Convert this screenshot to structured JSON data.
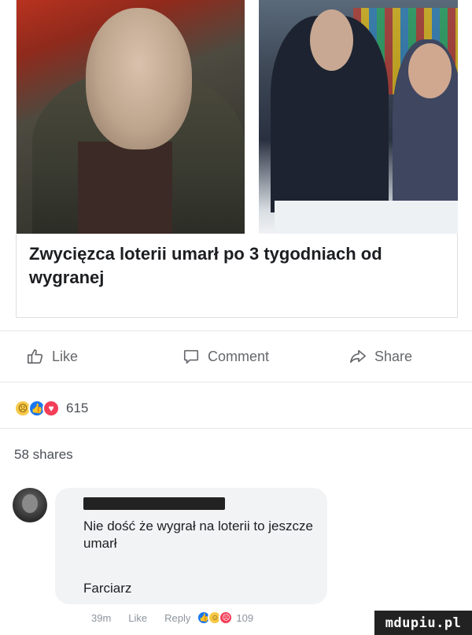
{
  "post": {
    "title": "Zwycięzca loterii umarł po 3 tygodniach od wygranej"
  },
  "actions": {
    "like_label": "Like",
    "comment_label": "Comment",
    "share_label": "Share"
  },
  "reactions": {
    "icons": [
      "sad-icon",
      "like-icon",
      "love-icon"
    ],
    "count": "615"
  },
  "shares": {
    "label": "58 shares"
  },
  "comment": {
    "text": "Nie dość że wygrał na loterii to jeszcze umarł",
    "signature": "Farciarz",
    "time": "39m",
    "like_label": "Like",
    "reply_label": "Reply",
    "reaction_count": "109"
  },
  "watermark": {
    "text": "mdupiu.pl"
  },
  "colors": {
    "like_blue": "#1877f2",
    "love_red": "#f33e58",
    "sad_yellow": "#f7c948",
    "bubble_bg": "#f2f3f5"
  }
}
